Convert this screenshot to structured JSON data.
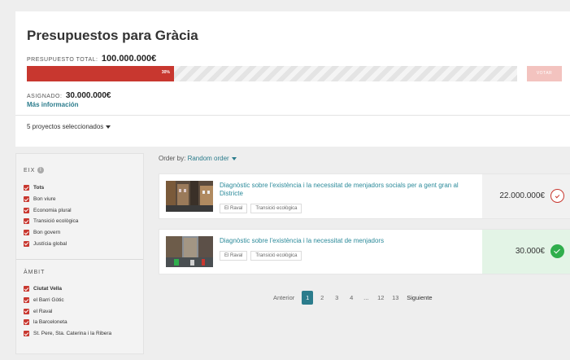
{
  "budget": {
    "title": "Presupuestos para Gràcia",
    "total_label": "Presupuesto total:",
    "total_value": "100.000.000€",
    "progress_percent_label": "30%",
    "progress_fraction": 0.3,
    "vote_button": "Votar",
    "assigned_label": "Asignado:",
    "assigned_value": "30.000.000€",
    "more_info": "Más información",
    "projects_selected": "5 proyectos seleccionados"
  },
  "filters": {
    "eix": {
      "heading": "EIX",
      "items": [
        {
          "label": "Tots",
          "checked": true,
          "bold": true
        },
        {
          "label": "Bon viure",
          "checked": true
        },
        {
          "label": "Economia plural",
          "checked": true
        },
        {
          "label": "Transició ecològica",
          "checked": true
        },
        {
          "label": "Bon govern",
          "checked": true
        },
        {
          "label": "Justícia global",
          "checked": true
        }
      ]
    },
    "ambit": {
      "heading": "ÀMBIT",
      "items": [
        {
          "label": "Ciutat Vella",
          "checked": true,
          "bold": true
        },
        {
          "label": "el Barri Gòtic",
          "checked": true
        },
        {
          "label": "el Raval",
          "checked": true
        },
        {
          "label": "la Barceloneta",
          "checked": true
        },
        {
          "label": "St. Pere, Sta. Caterina i la Ribera",
          "checked": true
        }
      ]
    }
  },
  "order": {
    "label": "Order by:",
    "value": "Random order"
  },
  "projects": [
    {
      "title": "Diagnòstic sobre l'existència i la necessitat de menjadors socials per a gent gran al Districte",
      "tags": [
        "El Raval",
        "Transició ecològica"
      ],
      "amount": "22.000.000€",
      "selected": false
    },
    {
      "title": "Diagnòstic sobre l'existència i la necessitat de menjadors",
      "tags": [
        "El Raval",
        "Transició ecològica"
      ],
      "amount": "30.000€",
      "selected": true
    }
  ],
  "pagination": {
    "previous": "Anterior",
    "pages": [
      "1",
      "2",
      "3",
      "4",
      "...",
      "12",
      "13"
    ],
    "current": "1",
    "next": "Siguiente"
  },
  "colors": {
    "accent_red": "#c8372f",
    "link_teal": "#2b7c8c",
    "selected_green": "#2fae4c"
  }
}
